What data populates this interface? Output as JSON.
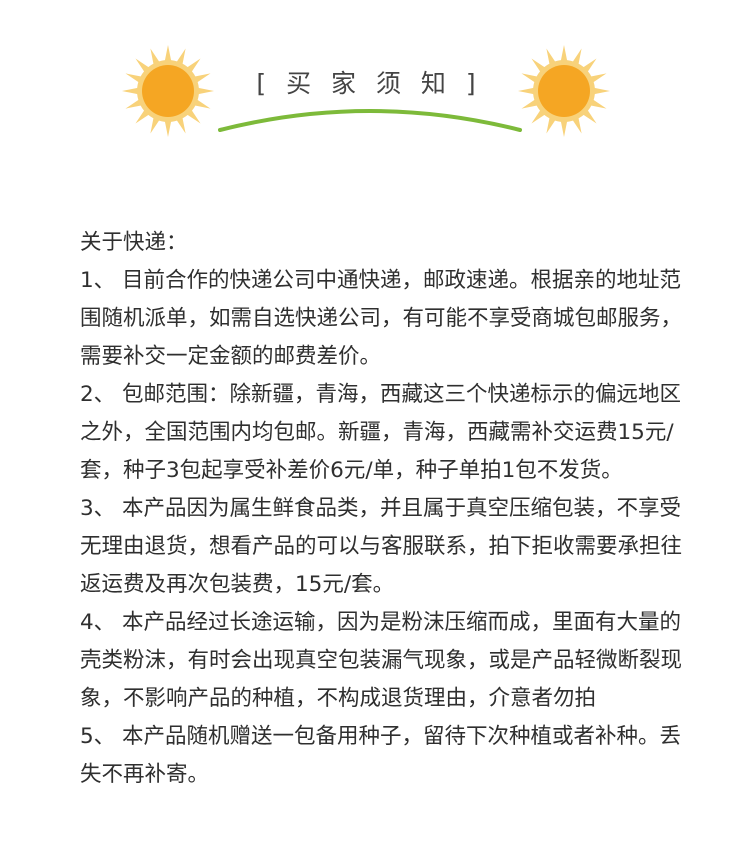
{
  "header": {
    "title": "[ 买 家 须 知 ]",
    "sun_color": "#F5A623",
    "ray_color": "#F8D27A",
    "arc_color": "#7DBA3A"
  },
  "content": {
    "heading": "关于快递：",
    "items": [
      "1、 目前合作的快递公司中通快递，邮政速递。根据亲的地址范围随机派单，如需自选快递公司，有可能不享受商城包邮服务，需要补交一定金额的邮费差价。",
      "2、 包邮范围：除新疆，青海，西藏这三个快递标示的偏远地区之外，全国范围内均包邮。新疆，青海，西藏需补交运费15元/套，种子3包起享受补差价6元/单，种子单拍1包不发货。",
      "3、 本产品因为属生鲜食品类，并且属于真空压缩包装，不享受无理由退货，想看产品的可以与客服联系，拍下拒收需要承担往返运费及再次包装费，15元/套。",
      "4、 本产品经过长途运输，因为是粉沫压缩而成，里面有大量的壳类粉沫，有时会出现真空包装漏气现象，或是产品轻微断裂现象，不影响产品的种植，不构成退货理由，介意者勿拍",
      "5、 本产品随机赠送一包备用种子，留待下次种植或者补种。丢失不再补寄。"
    ]
  }
}
